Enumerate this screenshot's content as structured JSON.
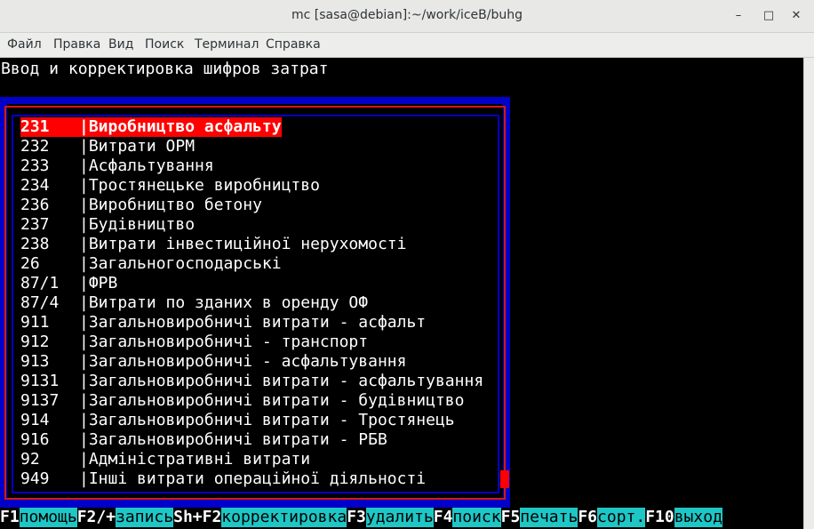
{
  "window": {
    "title": "mc [sasa@debian]:~/work/iceB/buhg",
    "minimize_glyph": "–",
    "maximize_glyph": "□",
    "close_glyph": "✕"
  },
  "menu": {
    "items": [
      "Файл",
      "Правка",
      "Вид",
      "Поиск",
      "Терминал",
      "Справка"
    ]
  },
  "screen": {
    "heading": "Ввод и корректировка шифров затрат",
    "rows": [
      {
        "code": "231",
        "name": "|Виробництво асфальту",
        "selected": true
      },
      {
        "code": "232",
        "name": "|Витрати ОРМ"
      },
      {
        "code": "233",
        "name": "|Асфальтування"
      },
      {
        "code": "234",
        "name": "|Тростянецьке виробництво"
      },
      {
        "code": "236",
        "name": "|Виробництво бетону"
      },
      {
        "code": "237",
        "name": "|Будівництво"
      },
      {
        "code": "238",
        "name": "|Витрати інвестиційної нерухомості"
      },
      {
        "code": "26",
        "name": "|Загальногосподарські"
      },
      {
        "code": "87/1",
        "name": "|ФРВ"
      },
      {
        "code": "87/4",
        "name": "|Витрати по зданих в оренду ОФ"
      },
      {
        "code": "911",
        "name": "|Загальновиробничі витрати - асфальт"
      },
      {
        "code": "912",
        "name": "|Загальновиробничі - транспорт"
      },
      {
        "code": "913",
        "name": "|Загальновиробничі - асфальтування"
      },
      {
        "code": "9131",
        "name": "|Загальновиробничі витрати - асфальтування"
      },
      {
        "code": "9137",
        "name": "|Загальновиробничі витрати - будівництво"
      },
      {
        "code": "914",
        "name": "|Загальновиробничі витрати - Тростянець"
      },
      {
        "code": "916",
        "name": "|Загальновиробничі витрати - РБВ"
      },
      {
        "code": "92",
        "name": "|Адміністративні витрати"
      },
      {
        "code": "949",
        "name": "|Інші витрати операційної діяльності"
      }
    ]
  },
  "function_keys": [
    {
      "key": "F1",
      "label": "помощь"
    },
    {
      "key": "F2/+",
      "label": "запись"
    },
    {
      "key": "Sh+F2",
      "label": "корректировка"
    },
    {
      "key": "F3",
      "label": "удалить"
    },
    {
      "key": "F4",
      "label": "поиск"
    },
    {
      "key": "F5",
      "label": "печать"
    },
    {
      "key": "F6",
      "label": "сорт."
    },
    {
      "key": "F10",
      "label": "выход"
    }
  ],
  "colors": {
    "selection": "#ff0000",
    "frame": "#0000c8",
    "fkey_label_bg": "#1fc6c6"
  }
}
